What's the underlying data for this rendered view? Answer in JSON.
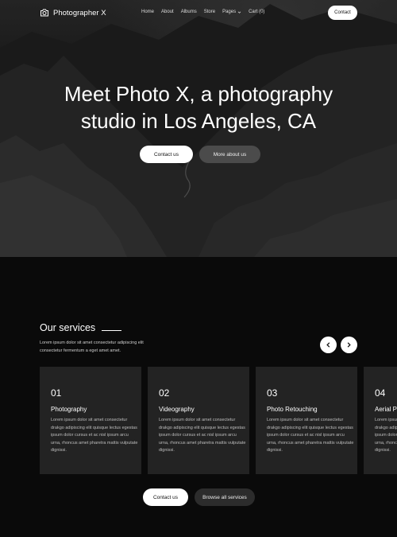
{
  "nav": {
    "logo_text": "Photographer X",
    "items": [
      {
        "label": "Home"
      },
      {
        "label": "About"
      },
      {
        "label": "Albums"
      },
      {
        "label": "Store"
      },
      {
        "label": "Pages"
      },
      {
        "label": "Cart (0)"
      }
    ],
    "contact_label": "Contact"
  },
  "hero": {
    "title_line1": "Meet Photo X, a photography",
    "title_line2": "studio in Los Angeles, CA",
    "contact_button": "Contact us",
    "about_button": "More about us"
  },
  "services": {
    "title": "Our services",
    "description": "Lorem ipsum dolor sit amet consectetur adipiscing elit consectetur fermentum a eget amet amet.",
    "cards": [
      {
        "number": "01",
        "title": "Photography",
        "text": "Lorem ipsum dolor sit amet consectetur drakgo adipiscing elit quisque lectus egestas ipsum dolor cursus et ac nisl ipsum arcu urna, rhoncus amet pharetra mattis vulputate dignissi."
      },
      {
        "number": "02",
        "title": "Videography",
        "text": "Lorem ipsum dolor sit amet consectetur drakgo adipiscing elit quisque lectus egestas ipsum dolor cursus et ac nisl ipsum arcu urna, rhoncus amet pharetra mattis vulputate dignissi."
      },
      {
        "number": "03",
        "title": "Photo Retouching",
        "text": "Lorem ipsum dolor sit amet consectetur drakgo adipiscing elit quisque lectus egestas ipsum dolor cursus et ac nisl ipsum arcu urna, rhoncus amet pharetra mattis vulputate dignissi."
      },
      {
        "number": "04",
        "title": "Aerial Photography",
        "text": "Lorem ipsum dolor sit amet consectetur drakgo adipiscing elit quisque lectus egestas ipsum dolor cursus et ac nisl ipsum arcu urna, rhoncus amet pharetra mattis vulputate dignissi."
      }
    ],
    "contact_button": "Contact us",
    "browse_button": "Browse all services"
  }
}
